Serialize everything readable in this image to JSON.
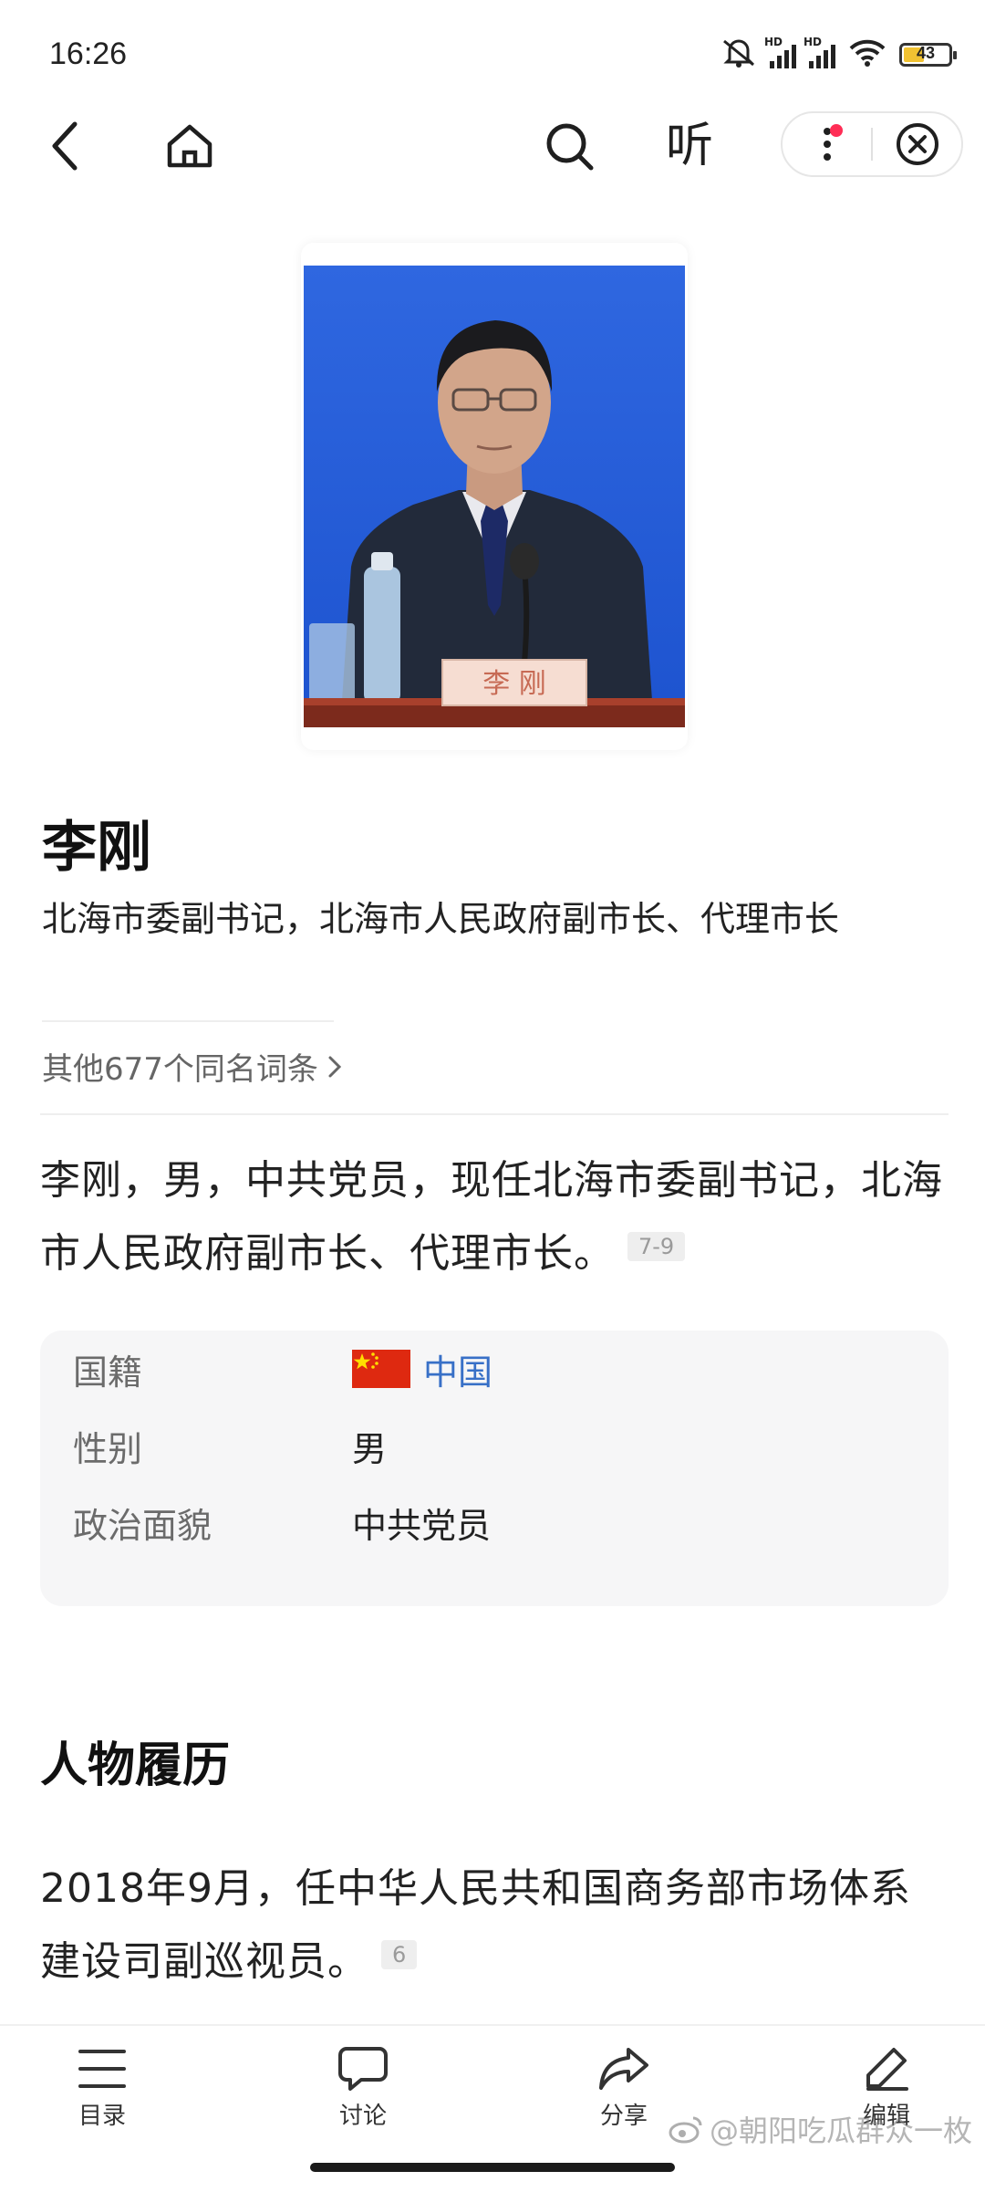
{
  "status_bar": {
    "time": "16:26",
    "hd1": "HD",
    "hd2": "HD",
    "battery": "43"
  },
  "nav": {
    "listen_label": "听"
  },
  "entry": {
    "photo_nameplate": "李 刚",
    "title": "李刚",
    "subtitle": "北海市委副书记，北海市人民政府副市长、代理市长",
    "same_name_link": "其他677个同名词条",
    "intro": "李刚，男，中共党员，现任北海市委副书记，北海市人民政府副市长、代理市长。",
    "intro_ref": "7-9"
  },
  "info": {
    "rows": [
      {
        "key": "国籍",
        "value": "中国"
      },
      {
        "key": "性别",
        "value": "男"
      },
      {
        "key": "政治面貌",
        "value": "中共党员"
      }
    ]
  },
  "career": {
    "section_title": "人物履历",
    "item_text": "2018年9月，任中华人民共和国商务部市场体系建设司副巡视员。",
    "item_ref": "6"
  },
  "bottom_bar": {
    "toc": "目录",
    "discuss": "讨论",
    "share": "分享",
    "edit": "编辑"
  },
  "watermark": "@朝阳吃瓜群众一枚",
  "colors": {
    "link_blue": "#3870c7",
    "photo_backdrop": "#2f67e0",
    "notification_dot": "#ff2d55"
  }
}
